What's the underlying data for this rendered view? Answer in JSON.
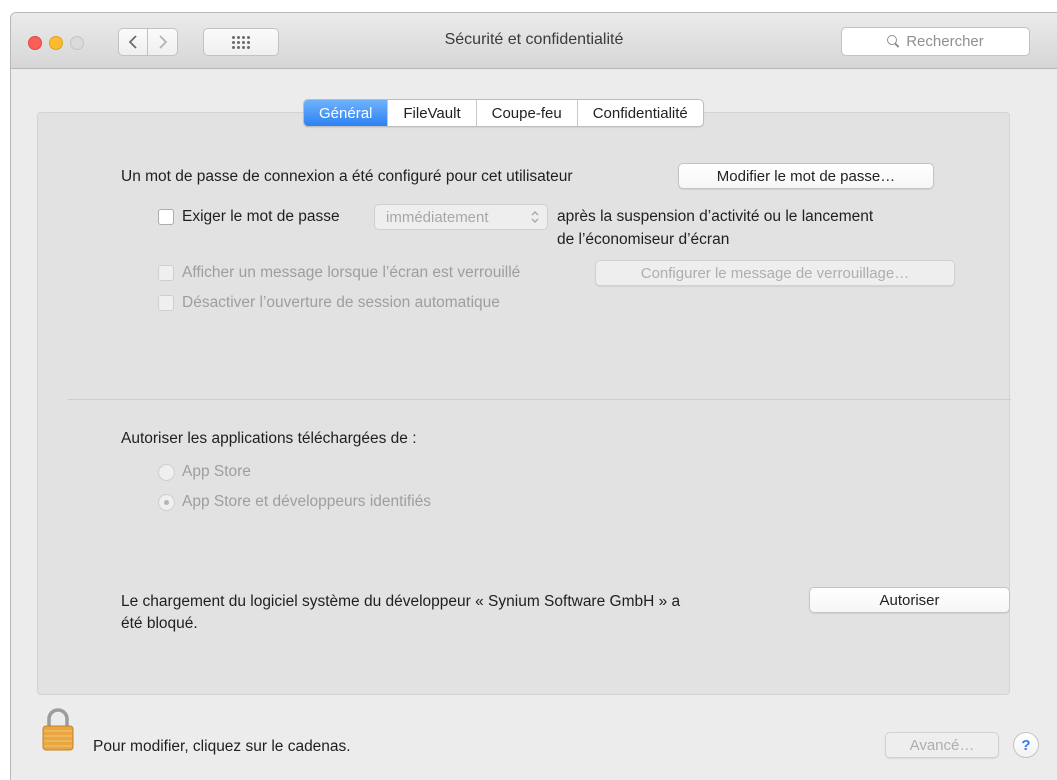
{
  "window": {
    "title": "Sécurité et confidentialité",
    "search_placeholder": "Rechercher"
  },
  "tabs": [
    {
      "label": "Général",
      "active": true
    },
    {
      "label": "FileVault",
      "active": false
    },
    {
      "label": "Coupe-feu",
      "active": false
    },
    {
      "label": "Confidentialité",
      "active": false
    }
  ],
  "general": {
    "password_text": "Un mot de passe de connexion a été configuré pour cet utilisateur",
    "change_password_button": "Modifier le mot de passe…",
    "require_password_label": "Exiger le mot de passe",
    "require_password_checked": false,
    "require_password_delay": "immédiatement",
    "require_password_suffix_line1": "après la suspension d’activité ou le lancement",
    "require_password_suffix_line2": "de l’économiseur d’écran",
    "show_message_label": "Afficher un message lorsque l’écran est verrouillé",
    "show_message_checked": false,
    "configure_message_button": "Configurer le message de verrouillage…",
    "disable_autologin_label": "Désactiver l’ouverture de session automatique",
    "disable_autologin_checked": false,
    "allow_apps_label": "Autoriser les applications téléchargées de :",
    "radio_app_store": "App Store",
    "radio_app_store_dev": "App Store et développeurs identifiés",
    "selected_source": "App Store et développeurs identifiés",
    "blocked_line1": "Le chargement du logiciel système du développeur « Synium Software GmbH » a",
    "blocked_line2": "été bloqué.",
    "allow_button": "Autoriser"
  },
  "footer": {
    "lock_text": "Pour modifier, cliquez sur le cadenas.",
    "advanced_button": "Avancé…",
    "help_label": "?"
  },
  "colors": {
    "accent": "#2c82f4",
    "lock_gold": "#e9a640"
  },
  "icons": {
    "back": "chevron-left-icon",
    "forward": "chevron-right-icon",
    "grid": "grid-icon",
    "search": "search-icon",
    "lock": "lock-icon",
    "popup": "up-down-arrows-icon"
  }
}
